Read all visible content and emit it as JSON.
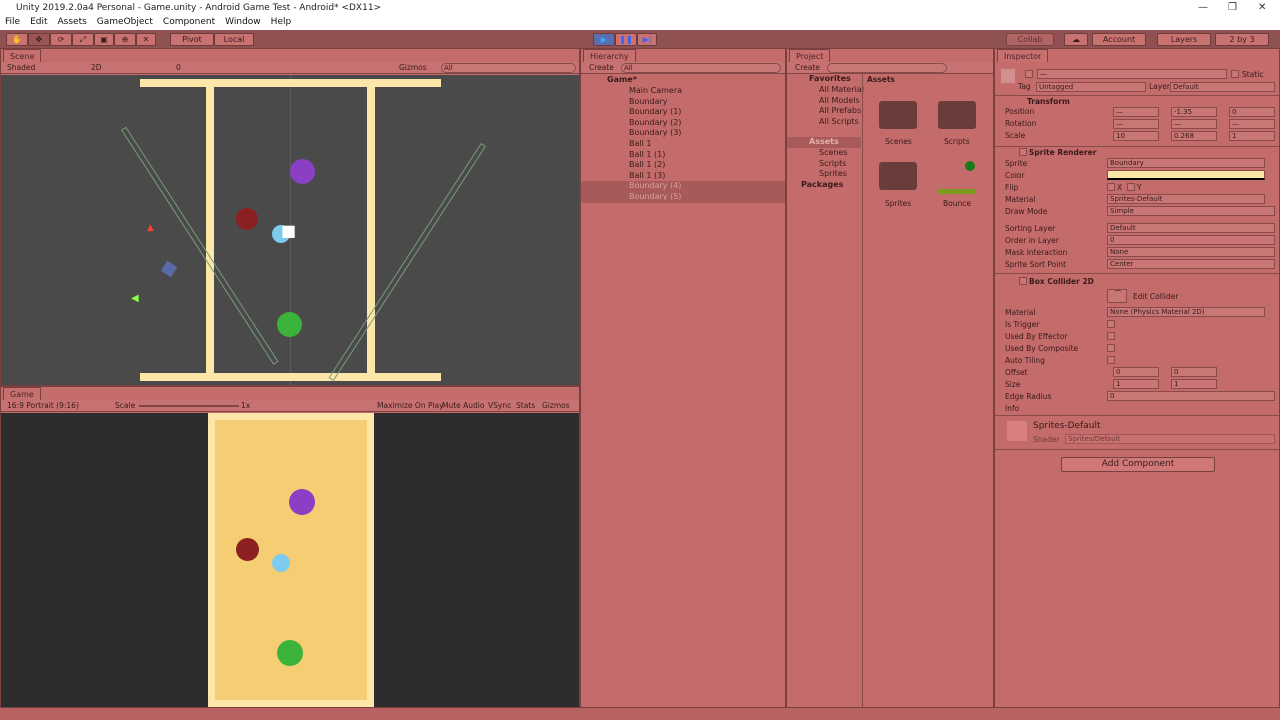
{
  "window": {
    "title": "Unity 2019.2.0a4 Personal - Game.unity - Android Game Test - Android* <DX11>",
    "min": "—",
    "max": "❐",
    "close": "✕"
  },
  "menu": [
    "File",
    "Edit",
    "Assets",
    "GameObject",
    "Component",
    "Window",
    "Help"
  ],
  "toolbar": {
    "tools": [
      "✋",
      "✥",
      "⟳",
      "⤢",
      "▣",
      "⊕",
      "✕"
    ],
    "pivot": "Pivot",
    "local": "Local",
    "play": "▶",
    "pause": "❚❚",
    "step": "▶|",
    "collab": "Collab",
    "cloud": "☁",
    "account": "Account",
    "layers": "Layers",
    "layout": "2 by 3"
  },
  "scene": {
    "tab": "Scene",
    "shading": "Shaded",
    "mode2d": "2D",
    "gizmos": "Gizmos",
    "search": "All",
    "hidden": "0"
  },
  "game": {
    "tab": "Game",
    "aspect": "16:9 Portrait (9:16)",
    "scale_label": "Scale",
    "scale_value": "1x",
    "scale_level": 0.0,
    "buttons": [
      "Maximize On Play",
      "Mute Audio",
      "VSync",
      "Stats",
      "Gizmos"
    ]
  },
  "hierarchy": {
    "tab": "Hierarchy",
    "create": "Create",
    "search": "All",
    "scene": "Game*",
    "items": [
      "Main Camera",
      "Boundary",
      "Boundary (1)",
      "Boundary (2)",
      "Boundary (3)",
      "Ball 1",
      "Ball 1 (1)",
      "Ball 1 (2)",
      "Ball 1 (3)",
      "Boundary (4)",
      "Boundary (5)"
    ]
  },
  "project": {
    "tab": "Project",
    "create": "Create",
    "favorites": "Favorites",
    "fav_items": [
      "All Material",
      "All Models",
      "All Prefabs",
      "All Scripts"
    ],
    "assets": "Assets",
    "asset_folders": [
      "Scenes",
      "Scripts",
      "Sprites"
    ],
    "packages": "Packages",
    "breadcrumb": "Assets",
    "grid": [
      "Scenes",
      "Scripts",
      "Sprites",
      "Bounce"
    ]
  },
  "inspector": {
    "tab": "Inspector",
    "name": "—",
    "static": "Static",
    "tag_label": "Tag",
    "tag": "Untagged",
    "layer_label": "Layer",
    "layer": "Default",
    "transform": {
      "title": "Transform",
      "rows": [
        {
          "label": "Position",
          "x": "—",
          "y": "-1.35",
          "z": "0"
        },
        {
          "label": "Rotation",
          "x": "—",
          "y": "—",
          "z": "—"
        },
        {
          "label": "Scale",
          "x": "10",
          "y": "0.268",
          "z": "1"
        }
      ]
    },
    "sprite_renderer": {
      "title": "Sprite Renderer",
      "sprite_label": "Sprite",
      "sprite": "Boundary",
      "color_label": "Color",
      "color": "#fde7a8",
      "flip_label": "Flip",
      "flip_x": "X",
      "flip_y": "Y",
      "material_label": "Material",
      "material": "Sprites-Default",
      "draw_mode_label": "Draw Mode",
      "draw_mode": "Simple",
      "sorting_layer_label": "Sorting Layer",
      "sorting_layer": "Default",
      "order_label": "Order in Layer",
      "order": "0",
      "mask_label": "Mask Interaction",
      "mask": "None",
      "sort_point_label": "Sprite Sort Point",
      "sort_point": "Center"
    },
    "box_collider": {
      "title": "Box Collider 2D",
      "edit": "Edit Collider",
      "material_label": "Material",
      "material": "None (Physics Material 2D)",
      "is_trigger": "Is Trigger",
      "used_by_effector": "Used By Effector",
      "used_by_composite": "Used By Composite",
      "auto_tiling": "Auto Tiling",
      "offset_label": "Offset",
      "offset_x": "0",
      "offset_y": "0",
      "size_label": "Size",
      "size_x": "1",
      "size_y": "1",
      "edge_radius_label": "Edge Radius",
      "edge_radius": "0",
      "info": "Info"
    },
    "material": {
      "name": "Sprites-Default",
      "shader_label": "Shader",
      "shader": "Sprites/Default"
    },
    "add_component": "Add Component"
  }
}
